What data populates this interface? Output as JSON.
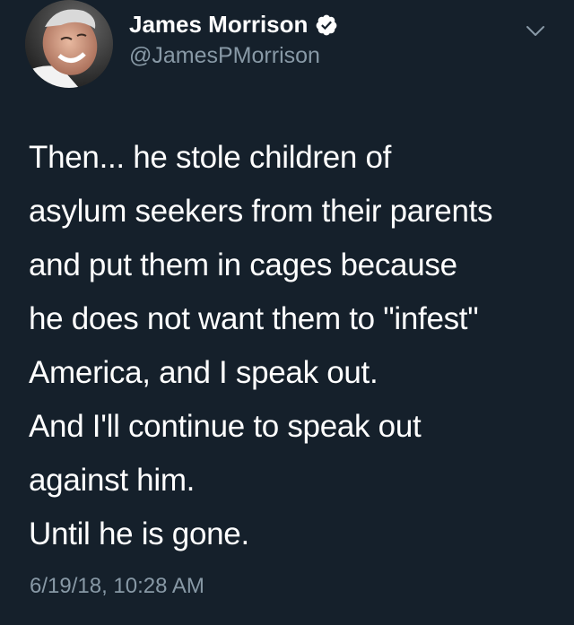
{
  "tweet": {
    "author": {
      "name": "James Morrison",
      "handle": "@JamesPMorrison",
      "verified": true,
      "avatar_icon": "avatar-photo"
    },
    "menu_icon": "chevron-down-icon",
    "text_lines": [
      "Then... he stole children of",
      "asylum seekers from their parents",
      "and put them in cages because",
      "he does not want them to \"infest\"",
      "America, and I speak out.",
      "And I'll continue to speak out",
      "against him.",
      "Until he is gone."
    ],
    "timestamp": "6/19/18, 10:28 AM"
  },
  "colors": {
    "background": "#15202b",
    "text_primary": "#ffffff",
    "text_secondary": "#8899a6",
    "verified_badge": "#ffffff"
  }
}
